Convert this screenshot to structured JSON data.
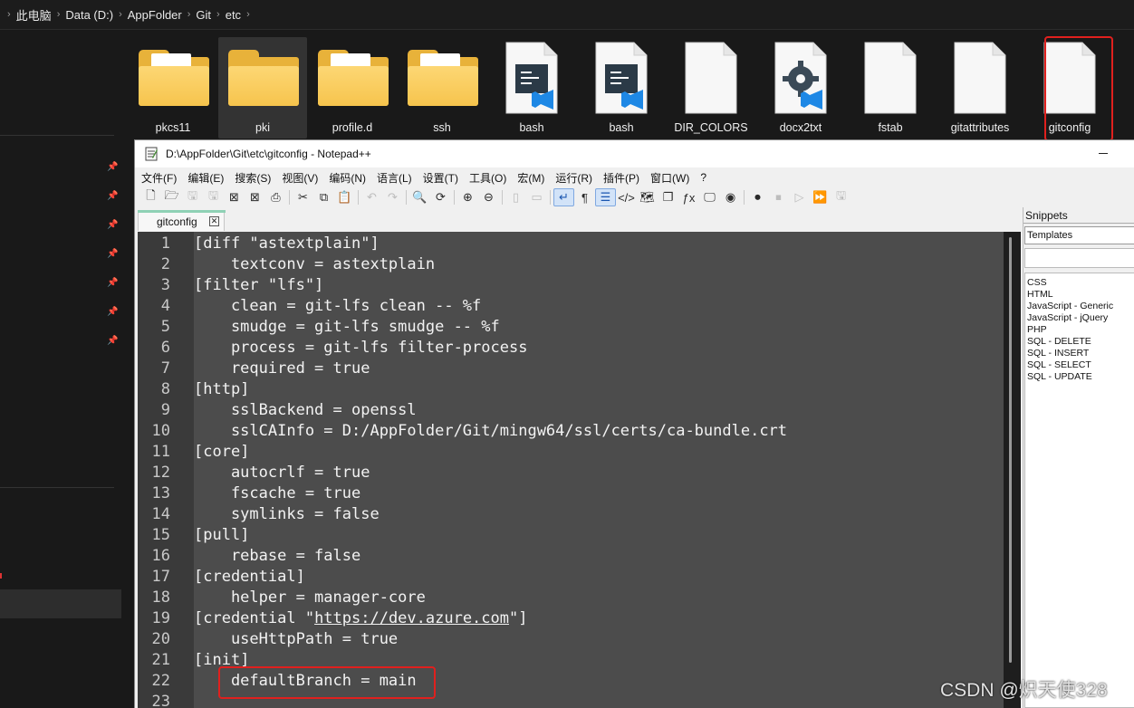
{
  "breadcrumb": [
    "此电脑",
    "Data (D:)",
    "AppFolder",
    "Git",
    "etc"
  ],
  "files": [
    {
      "name": "pkcs11",
      "kind": "folder",
      "icon": "folder-with-document-icon"
    },
    {
      "name": "pki",
      "kind": "folder",
      "icon": "folder-icon",
      "selected": true
    },
    {
      "name": "profile.d",
      "kind": "folder",
      "icon": "folder-with-document-icon"
    },
    {
      "name": "ssh",
      "kind": "folder",
      "icon": "folder-with-document-icon"
    },
    {
      "name": "bash",
      "kind": "vscode-file",
      "icon": "vscode-file-icon"
    },
    {
      "name": "bash",
      "kind": "vscode-file",
      "icon": "vscode-file-icon"
    },
    {
      "name": "DIR_COLORS",
      "kind": "file",
      "icon": "blank-file-icon"
    },
    {
      "name": "docx2txt",
      "kind": "gear-file",
      "icon": "gear-file-icon"
    },
    {
      "name": "fstab",
      "kind": "file",
      "icon": "blank-file-icon"
    },
    {
      "name": "gitattributes",
      "kind": "file",
      "icon": "blank-file-icon"
    },
    {
      "name": "gitconfig",
      "kind": "file",
      "icon": "blank-file-icon",
      "highlighted": true
    }
  ],
  "notepad": {
    "title": "D:\\AppFolder\\Git\\etc\\gitconfig - Notepad++",
    "menu": [
      "文件(F)",
      "编辑(E)",
      "搜索(S)",
      "视图(V)",
      "编码(N)",
      "语言(L)",
      "设置(T)",
      "工具(O)",
      "宏(M)",
      "运行(R)",
      "插件(P)",
      "窗口(W)",
      "?"
    ],
    "tab_label": "gitconfig",
    "lines": [
      "[diff \"astextplain\"]",
      "    textconv = astextplain",
      "[filter \"lfs\"]",
      "    clean = git-lfs clean -- %f",
      "    smudge = git-lfs smudge -- %f",
      "    process = git-lfs filter-process",
      "    required = true",
      "[http]",
      "    sslBackend = openssl",
      "    sslCAInfo = D:/AppFolder/Git/mingw64/ssl/certs/ca-bundle.crt",
      "[core]",
      "    autocrlf = true",
      "    fscache = true",
      "    symlinks = false",
      "[pull]",
      "    rebase = false",
      "[credential]",
      "    helper = manager-core",
      "[credential \"https://dev.azure.com\"]",
      "    useHttpPath = true",
      "[init]",
      "    defaultBranch = main",
      ""
    ]
  },
  "snippets": {
    "header": "Snippets",
    "selected": "Templates",
    "items": [
      "CSS",
      "HTML",
      "JavaScript - Generic",
      "JavaScript - jQuery",
      "PHP",
      "SQL - DELETE",
      "SQL - INSERT",
      "SQL - SELECT",
      "SQL - UPDATE"
    ]
  },
  "watermark": "CSDN @炽天使328",
  "colors": {
    "highlight": "#e0201e",
    "folder": "#f6c44d",
    "vscode_blue": "#1e88e5",
    "editor_bg": "#4c4c4c"
  }
}
